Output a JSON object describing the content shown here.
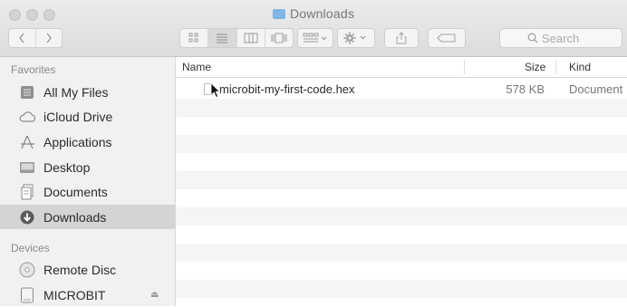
{
  "window": {
    "title": "Downloads"
  },
  "toolbar": {
    "search_placeholder": "Search"
  },
  "sidebar": {
    "favorites_header": "Favorites",
    "devices_header": "Devices",
    "favorites": [
      {
        "label": "All My Files",
        "icon": "all-files-icon"
      },
      {
        "label": "iCloud Drive",
        "icon": "cloud-icon"
      },
      {
        "label": "Applications",
        "icon": "applications-icon"
      },
      {
        "label": "Desktop",
        "icon": "desktop-icon"
      },
      {
        "label": "Documents",
        "icon": "documents-icon"
      },
      {
        "label": "Downloads",
        "icon": "downloads-icon",
        "selected": true
      }
    ],
    "devices": [
      {
        "label": "Remote Disc",
        "icon": "disc-icon"
      },
      {
        "label": "MICROBIT",
        "icon": "drive-icon",
        "ejectable": true
      }
    ]
  },
  "columns": {
    "name": "Name",
    "size": "Size",
    "kind": "Kind"
  },
  "files": [
    {
      "name": "microbit-my-first-code.hex",
      "size": "578 KB",
      "kind": "Document"
    }
  ],
  "colors": {
    "selected_sidebar": "#d4d4d4",
    "alt_row": "#f4f5f5",
    "folder_accent": "#7fb6e3"
  }
}
